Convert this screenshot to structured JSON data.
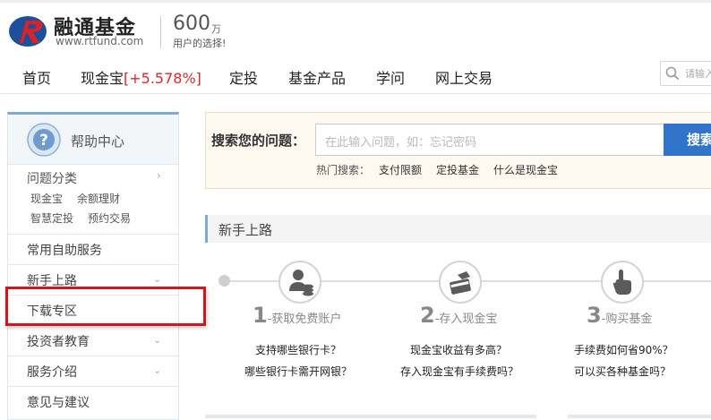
{
  "brand": {
    "name": "融通基金",
    "url": "www.rtfund.com",
    "slogan_number": "600",
    "slogan_unit": "万",
    "slogan_text": "用户的选择!"
  },
  "nav": {
    "items": [
      "首页",
      "现金宝",
      "定投",
      "基金产品",
      "学问",
      "网上交易"
    ],
    "cash_rate": "[+5.578%]",
    "search_placeholder": "请输入"
  },
  "sidebar": {
    "title": "帮助中心",
    "category_title": "问题分类",
    "category_links": [
      "现金宝",
      "余额理财",
      "智慧定投",
      "预约交易"
    ],
    "rows": [
      "常用自助服务",
      "新手上路",
      "下载专区",
      "投资者教育",
      "服务介绍",
      "意见与建议"
    ]
  },
  "question_search": {
    "label": "搜索您的问题：",
    "placeholder": "在此输入问题，如：忘记密码",
    "button": "搜索",
    "hot_label": "热门搜索：",
    "hot_links": [
      "支付限额",
      "定投基金",
      "什么是现金宝"
    ]
  },
  "beginner": {
    "title": "新手上路",
    "steps": [
      {
        "num": "1",
        "text": "-获取免费账户",
        "faqs": [
          "支持哪些银行卡？",
          "哪些银行卡需开网银？"
        ]
      },
      {
        "num": "2",
        "text": "-存入现金宝",
        "faqs": [
          "现金宝收益有多高？",
          "存入现金宝有手续费吗？"
        ]
      },
      {
        "num": "3",
        "text": "-购买基金",
        "faqs": [
          "手续费如何省90%？",
          "可以买各种基金吗？"
        ]
      }
    ]
  },
  "colors": {
    "accent_blue": "#2f74c8",
    "rate_red": "#d52b2b",
    "highlight_red": "#d3161c",
    "search_bg": "#fdf8f0"
  }
}
